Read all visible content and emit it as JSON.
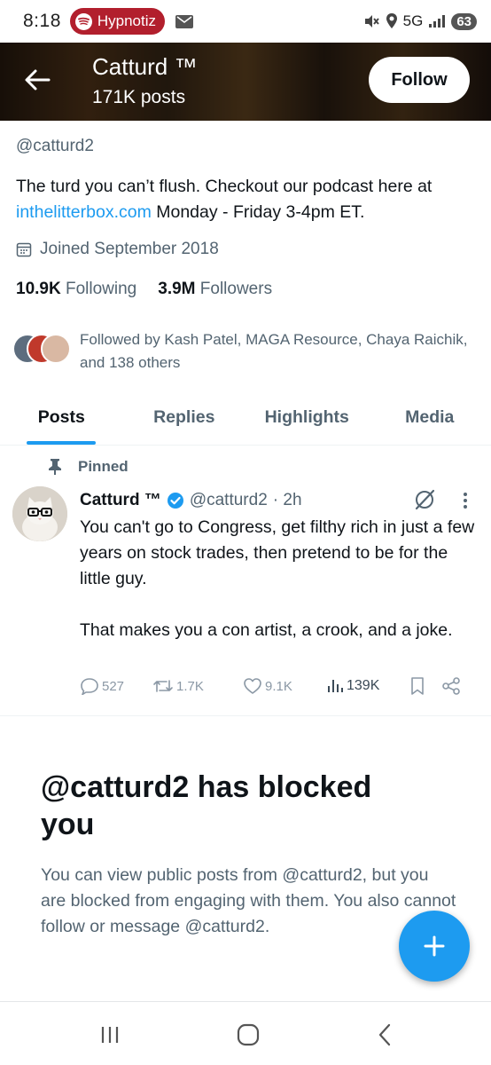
{
  "status_bar": {
    "time": "8:18",
    "media_app": "Hypnotiz",
    "network": "5G",
    "battery": "63"
  },
  "header": {
    "name": "Catturd ™",
    "posts_count": "171K posts",
    "follow_label": "Follow"
  },
  "profile": {
    "handle": "@catturd2",
    "bio_part1": "The turd you can’t flush.  Checkout our podcast here at ",
    "bio_link": "inthelitterbox.com",
    "bio_part2": " Monday - Friday 3-4pm ET.",
    "joined": "Joined September 2018",
    "following_count": "10.9K",
    "following_label": "Following",
    "followers_count": "3.9M",
    "followers_label": "Followers",
    "followed_by": "Followed by Kash Patel, MAGA Resource, Chaya Raichik, and 138 others"
  },
  "tabs": [
    {
      "label": "Posts",
      "active": true
    },
    {
      "label": "Replies",
      "active": false
    },
    {
      "label": "Highlights",
      "active": false
    },
    {
      "label": "Media",
      "active": false
    }
  ],
  "pinned_post": {
    "pinned_label": "Pinned",
    "author_name": "Catturd ™",
    "author_handle": "@catturd2",
    "time": "· 2h",
    "text": "You can't go to Congress, get filthy rich in just a few years on stock trades, then pretend to be for the little guy.\n\nThat makes you a con artist, a crook, and a joke.",
    "replies": "527",
    "reposts": "1.7K",
    "likes": "9.1K",
    "views": "139K"
  },
  "blocked": {
    "title": "@catturd2 has blocked you",
    "text": "You can view public posts from @catturd2, but you are blocked from engaging with them. You also cannot follow or message @catturd2."
  },
  "colors": {
    "accent": "#1d9bf0",
    "text": "#0f1419",
    "muted": "#536471",
    "media_pill": "#b21f2d"
  }
}
